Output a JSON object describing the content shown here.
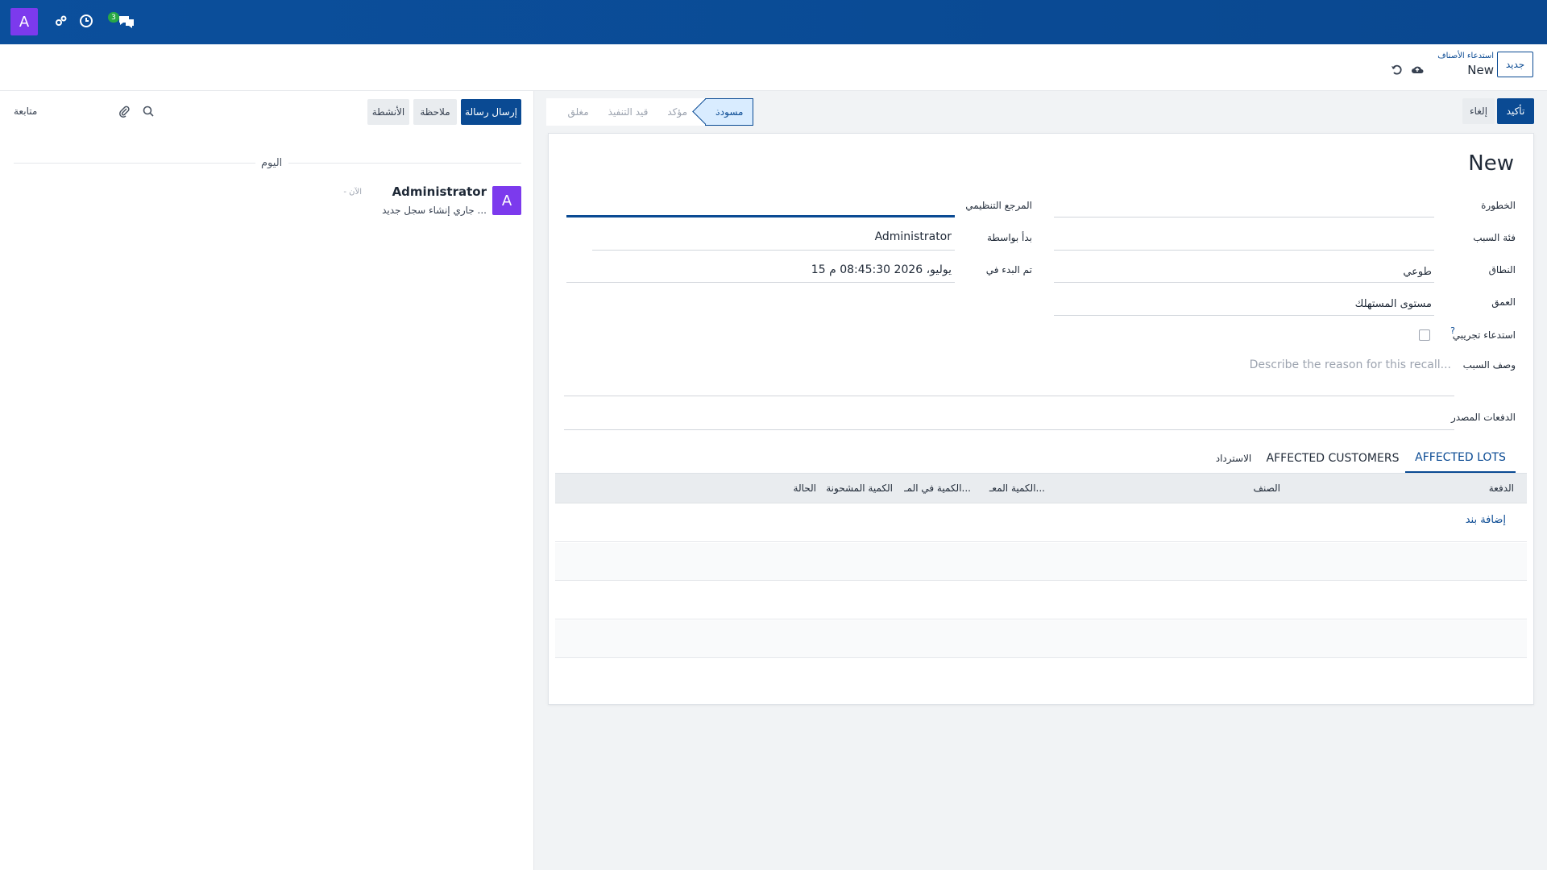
{
  "navbar": {
    "avatar": "A",
    "badge_count": "3",
    "icons": [
      "avatar",
      "settings-cog-icon",
      "clock-icon",
      "chat-icon"
    ]
  },
  "control": {
    "new_button": "جديد",
    "breadcrumb_parent": "استدعاء الأصناف",
    "breadcrumb_current": "New"
  },
  "actions": {
    "confirm": "تأكيد",
    "cancel": "إلغاء"
  },
  "statusbar": {
    "stages": [
      "مسودة",
      "مؤكد",
      "قيد التنفيذ",
      "مغلق"
    ],
    "active": "مسودة"
  },
  "form": {
    "title": "New",
    "fields": {
      "severity_label": "الخطورة",
      "cause_category_label": "فئة السبب",
      "scope_label": "النطاق",
      "scope_value": "طوعي",
      "depth_label": "العمق",
      "depth_value": "مستوى المستهلك",
      "mock_recall_label": "استدعاء تجريبي",
      "mock_recall_help": "?",
      "reason_label": "وصف السبب",
      "reason_placeholder": "Describe the reason for this recall...",
      "source_lots_label": "الدفعات المصدر",
      "reg_ref_label": "المرجع التنظيمي",
      "started_by_label": "بدأ بواسطة",
      "started_by_value": "Administrator",
      "started_on_label": "تم البدء في",
      "started_on_value": "15 يوليو، 2026 08:45:30 م"
    },
    "tabs": [
      "AFFECTED LOTS",
      "AFFECTED CUSTOMERS",
      "الاسترداد"
    ],
    "active_tab": "AFFECTED LOTS",
    "table": {
      "columns": [
        "الدفعة",
        "الصنف",
        "الكمية المعـ...",
        "الكمية في المـ...",
        "الكمية المشحونة",
        "الحالة"
      ],
      "add_line": "إضافة بند"
    }
  },
  "chatter": {
    "send_message": "إرسال رسالة",
    "log_note": "ملاحظة",
    "activities": "الأنشطة",
    "follow": "متابعة",
    "separator": "اليوم",
    "message": {
      "avatar": "A",
      "author": "Administrator",
      "time": "- الآن",
      "body": "جاري إنشاء سجل جديد ..."
    }
  }
}
